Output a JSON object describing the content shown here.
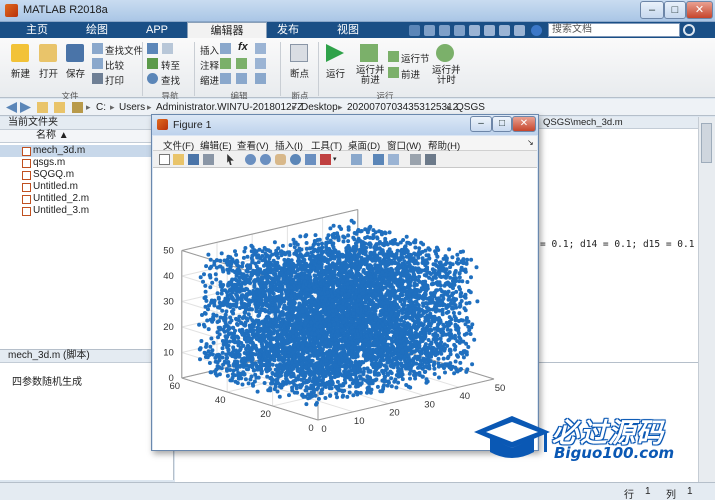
{
  "window": {
    "title": "MATLAB R2018a",
    "minimize": "–",
    "maximize": "□",
    "close": "✕"
  },
  "tabs": [
    {
      "label": "主页"
    },
    {
      "label": "绘图"
    },
    {
      "label": "APP"
    },
    {
      "label": "编辑器"
    },
    {
      "label": "发布"
    },
    {
      "label": "视图"
    }
  ],
  "search": {
    "placeholder": "搜索文档"
  },
  "ribbon": {
    "file": {
      "new": "新建",
      "open": "打开",
      "save": "保存",
      "find_files": "查找文件",
      "compare": "比较",
      "print": "打印",
      "group": "文件"
    },
    "nav": {
      "goto": "转至",
      "find": "查找",
      "group": "导航"
    },
    "edit": {
      "insert": "插入",
      "comment": "注释",
      "indent": "缩进",
      "fx": "fx",
      "group": "编辑"
    },
    "breakpoints": {
      "label": "断点",
      "group": "断点"
    },
    "run": {
      "run": "运行",
      "run_advance": "运行并\n前进",
      "run_section": "运行节",
      "advance": "前进",
      "run_time": "运行并\n计时",
      "group": "运行"
    }
  },
  "address": {
    "crumbs": [
      "C:",
      "Users",
      "Administrator.WIN7U-20180127Z",
      "Desktop",
      "20200707034353125312",
      "QSGS"
    ]
  },
  "left_panel": {
    "title": "当前文件夹",
    "column": "名称 ▲",
    "files": [
      "mech_3d.m",
      "qsgs.m",
      "SQGQ.m",
      "Untitled.m",
      "Untitled_2.m",
      "Untitled_3.m"
    ],
    "selected_index": 0
  },
  "details": {
    "title": "mech_3d.m  (脚本)",
    "text": "四参数随机生成"
  },
  "editor": {
    "tab": "QSGS\\mech_3d.m",
    "code_fragment": "= 0.1; d14 = 0.1; d15 = 0.1"
  },
  "figure": {
    "title": "Figure 1",
    "min": "–",
    "max": "□",
    "close": "✕",
    "menu": [
      "文件(F)",
      "编辑(E)",
      "查看(V)",
      "插入(I)",
      "工具(T)",
      "桌面(D)",
      "窗口(W)",
      "帮助(H)"
    ]
  },
  "chart_data": {
    "type": "scatter",
    "title": "",
    "xlabel": "",
    "ylabel": "",
    "zlabel": "",
    "x_ticks": [
      0,
      10,
      20,
      30,
      40,
      50
    ],
    "y_ticks": [
      0,
      20,
      40,
      60
    ],
    "z_ticks": [
      0,
      10,
      20,
      30,
      40,
      50
    ],
    "xlim": [
      0,
      50
    ],
    "ylim": [
      0,
      60
    ],
    "zlim": [
      0,
      50
    ],
    "color": "#1f6fbf",
    "grid": true,
    "description": "3D scatter of randomly generated points filling a cube"
  },
  "status": {
    "row_label": "行",
    "row": "1",
    "col_label": "列",
    "col": "1"
  },
  "logo": {
    "main": "必过源码",
    "url": "Biguo100.com"
  },
  "colors": {
    "ribbon_tab_bg": "#1a4f86",
    "accent": "#0a58b4",
    "points": "#1f6fbf"
  }
}
